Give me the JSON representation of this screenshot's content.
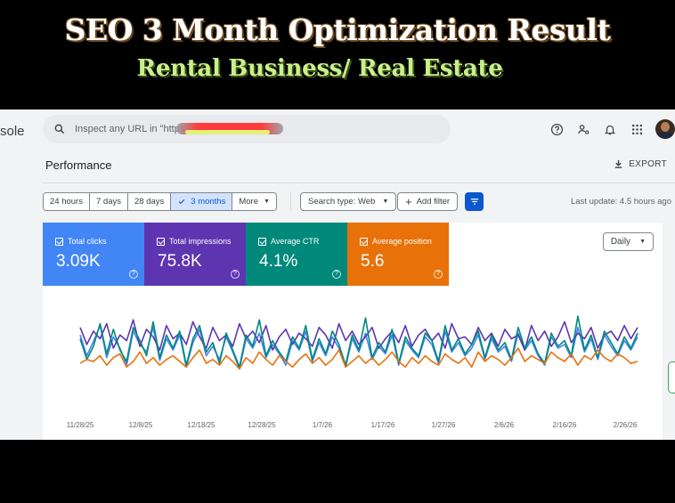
{
  "banner": {
    "headline": "SEO 3 Month Optimization Result",
    "subheadline": "Rental Business/ Real Estate"
  },
  "app": {
    "console_label": "sole",
    "search_placeholder": "Inspect any URL in \"https",
    "page_title": "Performance",
    "export_label": "EXPORT",
    "date_ranges": [
      {
        "label": "24 hours",
        "active": false
      },
      {
        "label": "7 days",
        "active": false
      },
      {
        "label": "28 days",
        "active": false
      },
      {
        "label": "3 months",
        "active": true
      },
      {
        "label": "More",
        "active": false
      }
    ],
    "search_type_label": "Search type: Web",
    "add_filter_label": "Add filter",
    "last_update": "Last update: 4.5 hours ago",
    "granularity": "Daily",
    "icons": [
      "search-icon",
      "help-icon",
      "manage-users-icon",
      "bell-icon",
      "apps-grid-icon",
      "download-icon",
      "filter-sort-icon"
    ]
  },
  "metrics": [
    {
      "label": "Total clicks",
      "value": "3.09K",
      "color": "#4285f4",
      "checked": true
    },
    {
      "label": "Total impressions",
      "value": "75.8K",
      "color": "#5e35b1",
      "checked": true
    },
    {
      "label": "Average CTR",
      "value": "4.1%",
      "color": "#00897b",
      "checked": true
    },
    {
      "label": "Average position",
      "value": "5.6",
      "color": "#e8710a",
      "checked": true
    }
  ],
  "chart_data": {
    "type": "line",
    "title": "",
    "xlabel": "",
    "ylabel": "",
    "x_ticks": [
      "11/28/25",
      "12/8/25",
      "12/18/25",
      "12/28/25",
      "1/7/26",
      "1/17/26",
      "1/27/26",
      "2/6/26",
      "2/16/26",
      "2/26/26"
    ],
    "x_range": [
      "11/28/25",
      "2/28/26"
    ],
    "y_axis_shown": false,
    "grid": false,
    "series": [
      {
        "name": "Total clicks",
        "color": "#4285f4",
        "values": [
          62,
          40,
          55,
          72,
          38,
          60,
          48,
          30,
          66,
          52,
          44,
          70,
          35,
          58,
          46,
          62,
          28,
          54,
          68,
          40,
          50,
          36,
          60,
          44,
          26,
          58,
          48,
          64,
          38,
          52,
          42,
          30,
          56,
          46,
          66,
          34,
          54,
          40,
          60,
          48,
          28,
          58,
          44,
          64,
          36,
          50,
          42,
          62,
          30,
          56,
          46,
          38,
          60,
          52,
          32,
          66,
          44,
          54,
          40,
          48,
          62,
          36,
          58,
          44,
          50,
          34,
          64,
          46,
          56,
          40,
          30,
          60,
          48,
          52,
          38,
          70,
          44,
          58,
          36,
          62,
          50,
          40,
          56,
          46,
          60
        ]
      },
      {
        "name": "Total impressions",
        "color": "#5e35b1",
        "values": [
          70,
          52,
          66,
          58,
          74,
          48,
          62,
          56,
          78,
          50,
          68,
          60,
          46,
          72,
          58,
          64,
          52,
          76,
          60,
          48,
          70,
          56,
          62,
          50,
          74,
          58,
          66,
          54,
          72,
          46,
          60,
          68,
          52,
          64,
          58,
          50,
          70,
          62,
          48,
          74,
          56,
          66,
          52,
          60,
          70,
          48,
          58,
          66,
          54,
          72,
          50,
          62,
          68,
          56,
          64,
          48,
          74,
          58,
          60,
          52,
          70,
          56,
          64,
          50,
          68,
          58,
          62,
          46,
          72,
          56,
          66,
          50,
          60,
          76,
          54,
          64,
          58,
          70,
          48,
          62,
          66,
          56,
          72,
          58,
          70
        ]
      },
      {
        "name": "Average CTR",
        "color": "#00897b",
        "values": [
          58,
          36,
          50,
          74,
          42,
          68,
          46,
          34,
          70,
          56,
          40,
          76,
          38,
          62,
          48,
          66,
          30,
          58,
          72,
          44,
          54,
          32,
          64,
          46,
          28,
          62,
          50,
          78,
          40,
          56,
          44,
          34,
          60,
          48,
          72,
          36,
          58,
          42,
          66,
          52,
          30,
          62,
          46,
          80,
          38,
          54,
          44,
          68,
          32,
          60,
          48,
          40,
          64,
          56,
          34,
          72,
          46,
          58,
          42,
          52,
          66,
          38,
          62,
          46,
          54,
          36,
          70,
          48,
          60,
          42,
          32,
          64,
          50,
          56,
          40,
          82,
          46,
          62,
          38,
          66,
          54,
          42,
          60,
          48,
          64
        ]
      },
      {
        "name": "Average position",
        "color": "#e8710a",
        "values": [
          32,
          36,
          34,
          40,
          30,
          38,
          42,
          28,
          34,
          44,
          32,
          38,
          30,
          36,
          40,
          34,
          28,
          38,
          46,
          32,
          36,
          30,
          40,
          34,
          26,
          38,
          32,
          44,
          36,
          30,
          40,
          34,
          28,
          36,
          42,
          32,
          38,
          30,
          36,
          46,
          28,
          34,
          40,
          32,
          38,
          30,
          36,
          44,
          34,
          28,
          38,
          32,
          40,
          34,
          30,
          42,
          36,
          32,
          38,
          28,
          44,
          34,
          40,
          36,
          30,
          38,
          48,
          34,
          40,
          36,
          32,
          44,
          38,
          34,
          42,
          30,
          40,
          36,
          46,
          38,
          34,
          42,
          38,
          32,
          34
        ]
      }
    ]
  }
}
